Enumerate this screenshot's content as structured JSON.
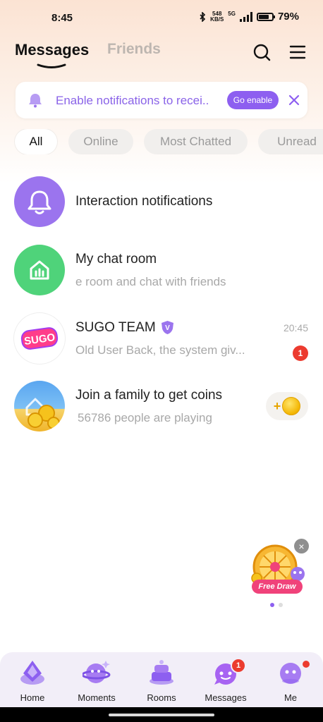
{
  "status_bar": {
    "time": "8:45",
    "net_speed_value": "548",
    "net_speed_unit": "KB/S",
    "network": "5G",
    "battery": "79%",
    "battery_level": 0.79,
    "icons": [
      "bluetooth-icon",
      "signal-icon",
      "battery-icon"
    ]
  },
  "header": {
    "tabs": [
      {
        "label": "Messages",
        "active": true
      },
      {
        "label": "Friends",
        "active": false
      }
    ],
    "icons": [
      "search-icon",
      "menu-icon"
    ]
  },
  "notification_banner": {
    "text": "Enable notifications to recei..",
    "button_label": "Go enable",
    "icon": "bell-icon",
    "close_icon": "close-icon"
  },
  "filters": [
    {
      "label": "All",
      "active": true
    },
    {
      "label": "Online",
      "active": false
    },
    {
      "label": "Most Chatted",
      "active": false
    },
    {
      "label": "Unread",
      "active": false
    }
  ],
  "chats": [
    {
      "title": "Interaction notifications",
      "subtitle": "",
      "time": "",
      "unread": "",
      "icon": "bell-icon"
    },
    {
      "title": "My chat room",
      "subtitle": "e room and chat with friends",
      "time": "",
      "unread": "",
      "icon": "room-icon"
    },
    {
      "title": "SUGO TEAM",
      "subtitle": "Old User Back, the system giv...",
      "time": "20:45",
      "unread": "1",
      "verified_badge": "V",
      "icon": "sugo-logo"
    },
    {
      "title": "Join a family to get coins",
      "subtitle": "56786 people are playing",
      "time": "",
      "unread": "",
      "coin_reward": "+",
      "icon": "family-coins-icon"
    }
  ],
  "floating_widget": {
    "label": "Free Draw",
    "close": "×",
    "page_dots": 2,
    "active_dot": 0
  },
  "bottom_nav": [
    {
      "label": "Home",
      "icon": "home-icon",
      "badge": ""
    },
    {
      "label": "Moments",
      "icon": "moments-icon",
      "badge": ""
    },
    {
      "label": "Rooms",
      "icon": "rooms-icon",
      "badge": ""
    },
    {
      "label": "Messages",
      "icon": "messages-icon",
      "badge": "1"
    },
    {
      "label": "Me",
      "icon": "me-icon",
      "badge": "dot"
    }
  ],
  "colors": {
    "accent_purple": "#8d5ff0",
    "badge_red": "#ec3b2f",
    "header_gradient_top": "#fbe3d3",
    "chat_room_green": "#4fd37a",
    "interaction_purple": "#9b74ee"
  }
}
